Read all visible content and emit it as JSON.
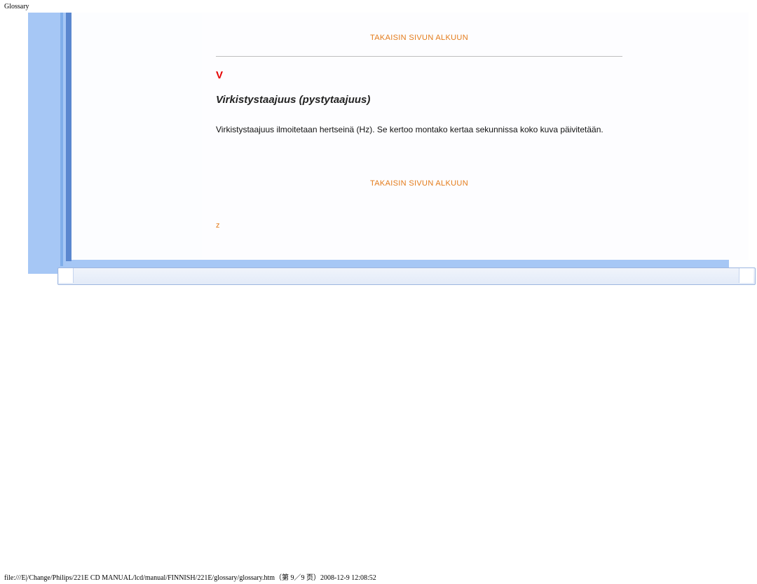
{
  "header": {
    "small_title": "Glossary"
  },
  "content": {
    "top_link": "TAKAISIN SIVUN ALKUUN",
    "section_letter": "V",
    "term_title": "Virkistystaajuus (pystytaajuus)",
    "body": "Virkistystaajuus ilmoitetaan hertseinä (Hz). Se kertoo montako kertaa sekunnissa koko kuva päivitetään.",
    "bottom_link": "TAKAISIN SIVUN ALKUUN",
    "letter_z": "z"
  },
  "footer": {
    "path": "file:///E|/Change/Philips/221E CD MANUAL/lcd/manual/FINNISH/221E/glossary/glossary.htm（第 9／9 页）2008-12-9 12:08:52"
  }
}
